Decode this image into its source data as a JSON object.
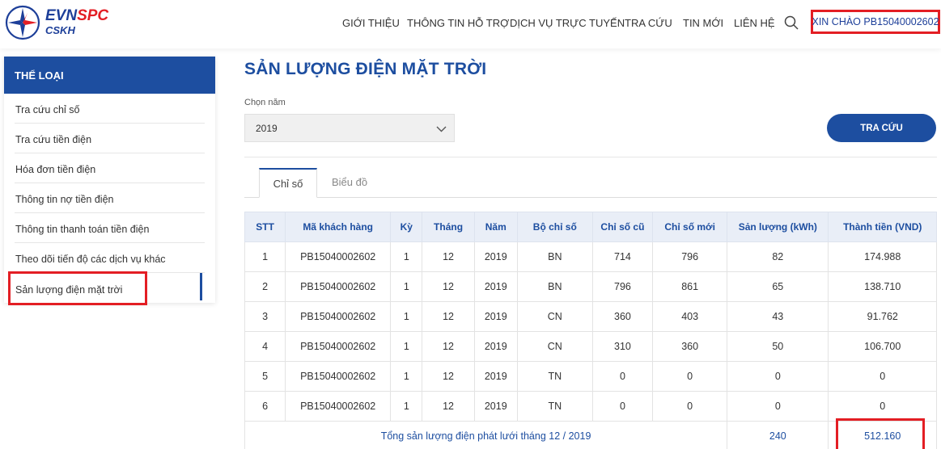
{
  "brand": {
    "evn": "EVN",
    "spc": "SPC",
    "cskh": "CSKH",
    "colors": {
      "primary": "#1d4ea0",
      "accent": "#e31e24"
    }
  },
  "nav": {
    "items": [
      "GIỚI THIỆU",
      "THÔNG TIN HỖ TRỢ",
      "DỊCH VỤ TRỰC TUYẾN",
      "TRA CỨU",
      "TIN MỚI",
      "LIÊN HỆ"
    ],
    "search_icon": "search-icon",
    "greeting": "XIN CHÀO PB15040002602"
  },
  "sidebar": {
    "title": "THỂ LOẠI",
    "items": [
      "Tra cứu chỉ số",
      "Tra cứu tiền điện",
      "Hóa đơn tiền điện",
      "Thông tin nợ tiền điện",
      "Thông tin thanh toán tiền điện",
      "Theo dõi tiến độ các dịch vụ khác",
      "Sản lượng điện mặt trời"
    ],
    "active_index": 6
  },
  "main": {
    "title": "SẢN LƯỢNG ĐIỆN MẶT TRỜI",
    "year_label": "Chọn năm",
    "year_value": "2019",
    "search_button": "TRA CỨU",
    "tabs": [
      "Chỉ số",
      "Biểu đồ"
    ],
    "active_tab": 0
  },
  "table": {
    "headers": [
      "STT",
      "Mã khách hàng",
      "Kỳ",
      "Tháng",
      "Năm",
      "Bộ chỉ số",
      "Chỉ số cũ",
      "Chỉ số mới",
      "Sản lượng (kWh)",
      "Thành tiền (VND)"
    ],
    "rows": [
      [
        "1",
        "PB15040002602",
        "1",
        "12",
        "2019",
        "BN",
        "714",
        "796",
        "82",
        "174.988"
      ],
      [
        "2",
        "PB15040002602",
        "1",
        "12",
        "2019",
        "BN",
        "796",
        "861",
        "65",
        "138.710"
      ],
      [
        "3",
        "PB15040002602",
        "1",
        "12",
        "2019",
        "CN",
        "360",
        "403",
        "43",
        "91.762"
      ],
      [
        "4",
        "PB15040002602",
        "1",
        "12",
        "2019",
        "CN",
        "310",
        "360",
        "50",
        "106.700"
      ],
      [
        "5",
        "PB15040002602",
        "1",
        "12",
        "2019",
        "TN",
        "0",
        "0",
        "0",
        "0"
      ],
      [
        "6",
        "PB15040002602",
        "1",
        "12",
        "2019",
        "TN",
        "0",
        "0",
        "0",
        "0"
      ]
    ],
    "total": {
      "label": "Tổng sản lượng điện phát lưới tháng 12 / 2019",
      "kwh": "240",
      "amount": "512.160"
    }
  }
}
